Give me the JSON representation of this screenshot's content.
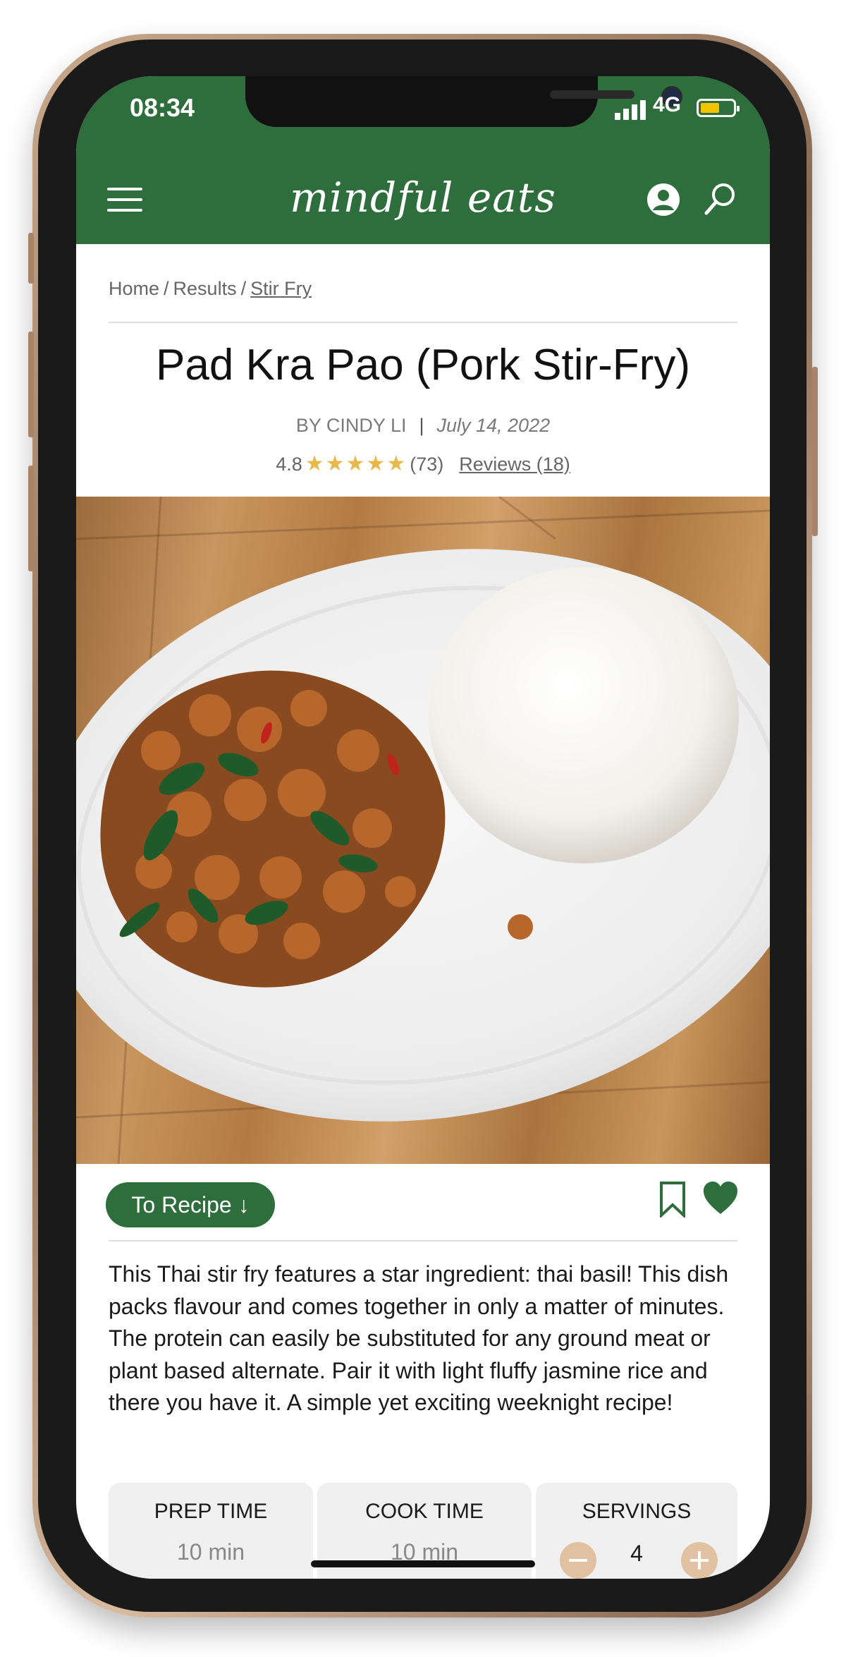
{
  "status_bar": {
    "time": "08:34",
    "network": "4G"
  },
  "header": {
    "logo": "mindful eats"
  },
  "breadcrumb": {
    "items": [
      "Home",
      "Results"
    ],
    "current": "Stir Fry",
    "separator": "/"
  },
  "recipe": {
    "title": "Pad Kra Pao (Pork Stir-Fry)",
    "author": "BY CINDY LI",
    "date": "July 14, 2022",
    "rating": "4.8",
    "stars": "★★★★★",
    "rating_count": "(73)",
    "reviews_link": "Reviews (18)",
    "rating_value": 4.8,
    "description": "This Thai stir fry features a star ingredient: thai basil! This dish packs flavour and comes together in only a matter of minutes. The protein can easily be substituted for any ground meat or plant based alternate. Pair it with light fluffy jasmine rice and there you have it. A simple yet exciting weeknight recipe!"
  },
  "actions": {
    "to_recipe": "To Recipe ↓"
  },
  "stats": {
    "prep_label": "PREP TIME",
    "prep_value": "10 min",
    "cook_label": "COOK TIME",
    "cook_value": "10 min",
    "servings_label": "SERVINGS",
    "servings_value": "4"
  },
  "colors": {
    "brand_green": "#2e6e3c",
    "star_gold": "#e8b84a",
    "stepper_tan": "#e0c2a2"
  }
}
